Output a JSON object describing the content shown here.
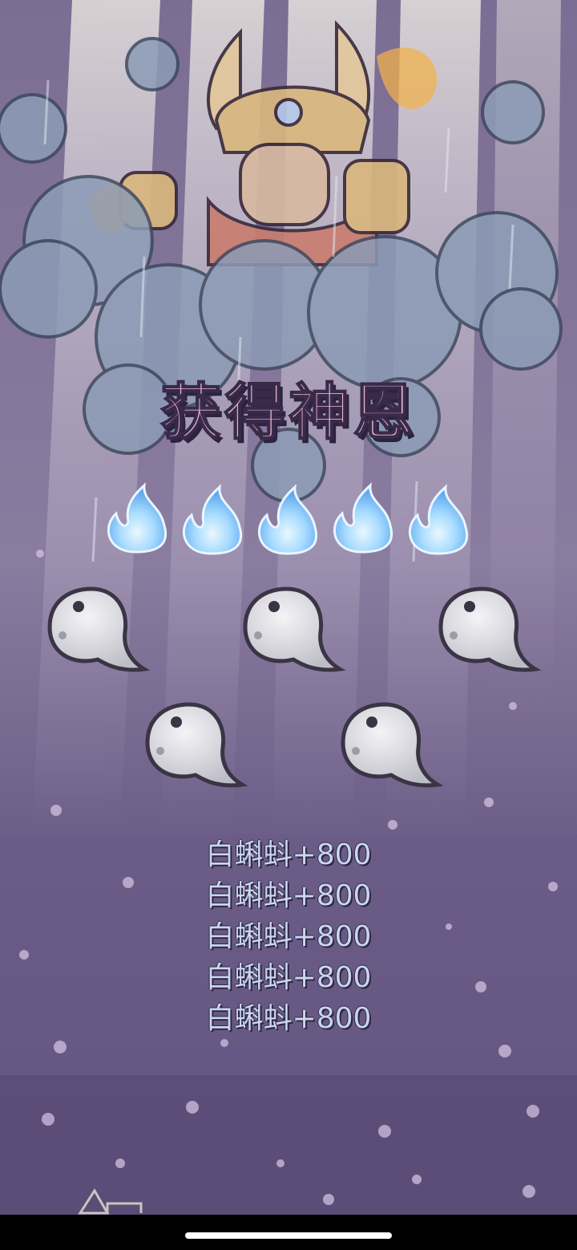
{
  "popup": {
    "title": "获得神恩",
    "flame_icon": "blue-flame-icon",
    "flame_count": 5,
    "reward_icon": "white-tadpole-icon",
    "rewards": [
      {
        "text": "白蝌蚪+800"
      },
      {
        "text": "白蝌蚪+800"
      },
      {
        "text": "白蝌蚪+800"
      },
      {
        "text": "白蝌蚪+800"
      },
      {
        "text": "白蝌蚪+800"
      }
    ]
  },
  "colors": {
    "background": "#5c4f7a",
    "flame": "#9fd3ff",
    "tadpole": "#d9d9df",
    "reward_text": "#c9d6ee"
  }
}
